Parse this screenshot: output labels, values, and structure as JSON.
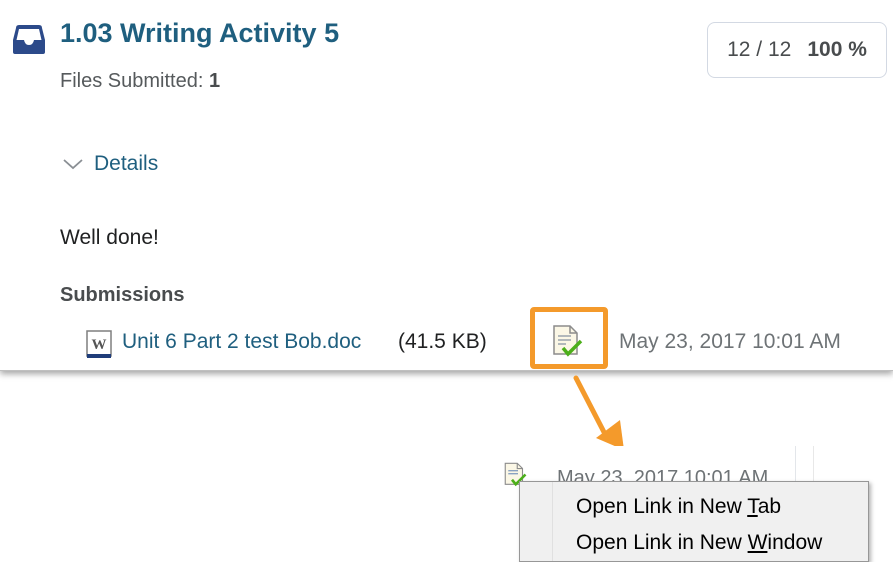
{
  "assignment": {
    "title": "1.03 Writing Activity 5",
    "files_submitted_label": "Files Submitted:",
    "files_submitted_count": "1",
    "icon": "dropbox-icon"
  },
  "score": {
    "points": "12 / 12",
    "percent": "100 %"
  },
  "details": {
    "label": "Details",
    "icon": "chevron-down-icon"
  },
  "feedback": "Well done!",
  "submissions": {
    "heading": "Submissions",
    "file": {
      "name": "Unit 6 Part 2 test Bob.doc",
      "size": "(41.5 KB)",
      "icon": "word-doc-icon",
      "status_icon": "document-check-icon",
      "date": "May 23, 2017 10:01 AM"
    }
  },
  "zoom": {
    "date": "May 23, 2017 10:01 AM",
    "context_menu": [
      {
        "pre": "Open Link in New ",
        "key": "T",
        "post": "ab"
      },
      {
        "pre": "Open Link in New ",
        "key": "W",
        "post": "indow"
      }
    ]
  },
  "colors": {
    "link": "#1f5f7f",
    "highlight": "#f49a2b"
  }
}
